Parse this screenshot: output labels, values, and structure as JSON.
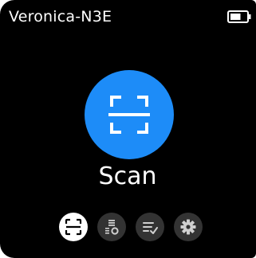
{
  "status_bar": {
    "device_name": "Veronica-N3E",
    "battery_icon": "battery-icon",
    "battery_level": 0.66
  },
  "main": {
    "scan_icon": "scan-frame-icon",
    "scan_label": "Scan",
    "accent_color": "#1d8cf8"
  },
  "dock": {
    "items": [
      {
        "icon": "scan-icon",
        "active": true
      },
      {
        "icon": "barcode-list-icon",
        "active": false
      },
      {
        "icon": "checklist-icon",
        "active": false
      },
      {
        "icon": "gear-icon",
        "active": false
      }
    ]
  }
}
